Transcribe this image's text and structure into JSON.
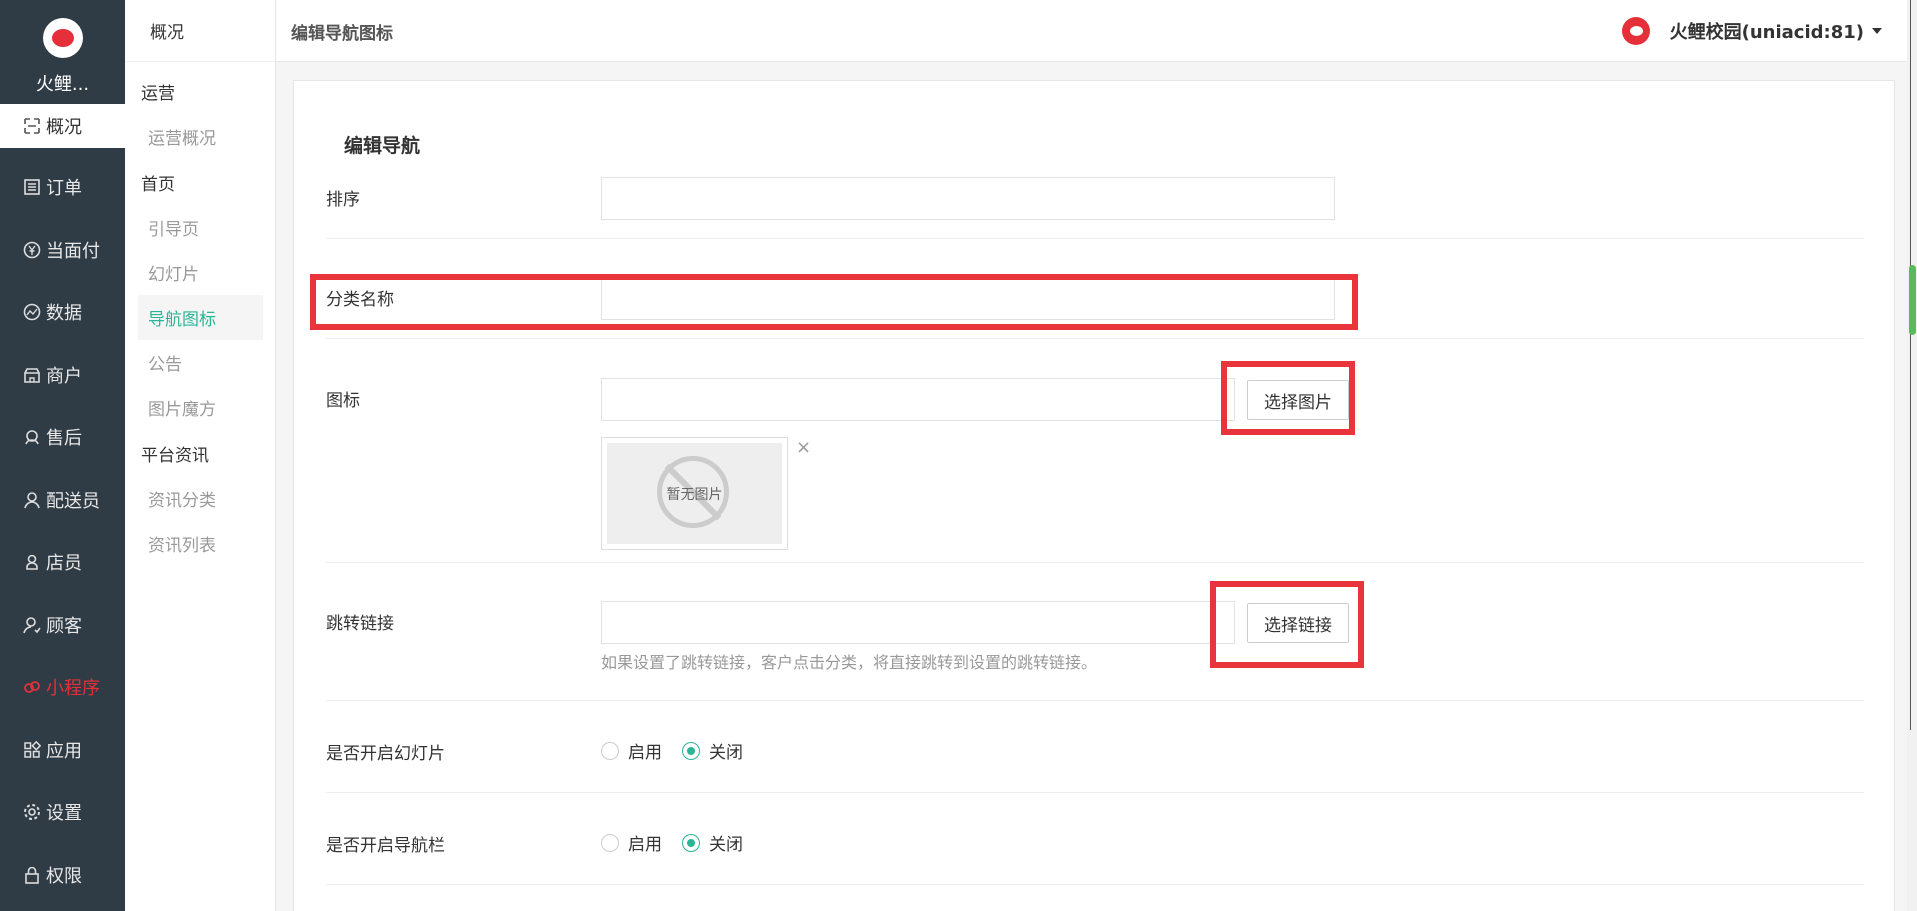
{
  "brand": {
    "name": "火鲤..."
  },
  "sidebar": {
    "items": [
      {
        "label": "概况",
        "icon": "overview-icon",
        "active": true
      },
      {
        "label": "订单",
        "icon": "order-icon"
      },
      {
        "label": "当面付",
        "icon": "yuan-icon"
      },
      {
        "label": "数据",
        "icon": "chart-icon"
      },
      {
        "label": "商户",
        "icon": "store-icon"
      },
      {
        "label": "售后",
        "icon": "headset-icon"
      },
      {
        "label": "配送员",
        "icon": "user-icon"
      },
      {
        "label": "店员",
        "icon": "staff-icon"
      },
      {
        "label": "顾客",
        "icon": "customer-icon"
      },
      {
        "label": "小程序",
        "icon": "miniapp-icon",
        "highlight_color": "#e5303a"
      },
      {
        "label": "应用",
        "icon": "apps-icon"
      },
      {
        "label": "设置",
        "icon": "gear-icon"
      },
      {
        "label": "权限",
        "icon": "lock-icon"
      }
    ]
  },
  "subnav": {
    "head": "概况",
    "groups": [
      {
        "title": "运营",
        "items": [
          "运营概况"
        ]
      },
      {
        "title": "首页",
        "items": [
          "引导页",
          "幻灯片",
          "导航图标",
          "公告",
          "图片魔方"
        ]
      },
      {
        "title": "平台资讯",
        "items": [
          "资讯分类",
          "资讯列表"
        ]
      }
    ],
    "active_item": "导航图标"
  },
  "topbar": {
    "crumb": "编辑导航图标",
    "user": "火鲤校园(uniacid:81)"
  },
  "form": {
    "title": "编辑导航",
    "sort_label": "排序",
    "sort_value": "",
    "name_label": "分类名称",
    "name_value": "",
    "icon_label": "图标",
    "icon_value": "",
    "choose_image": "选择图片",
    "no_image": "暂无图片",
    "close_glyph": "×",
    "link_label": "跳转链接",
    "link_value": "",
    "choose_link": "选择链接",
    "link_help": "如果设置了跳转链接，客户点击分类，将直接跳转到设置的跳转链接。",
    "slide_label": "是否开启幻灯片",
    "navbar_label": "是否开启导航栏",
    "enable": "启用",
    "disable": "关闭",
    "slide_selected": "关闭",
    "navbar_selected": "关闭"
  },
  "colors": {
    "accent": "#2bb596",
    "highlight_box": "#e8343a",
    "sidebar_bg": "#2f3b45"
  }
}
